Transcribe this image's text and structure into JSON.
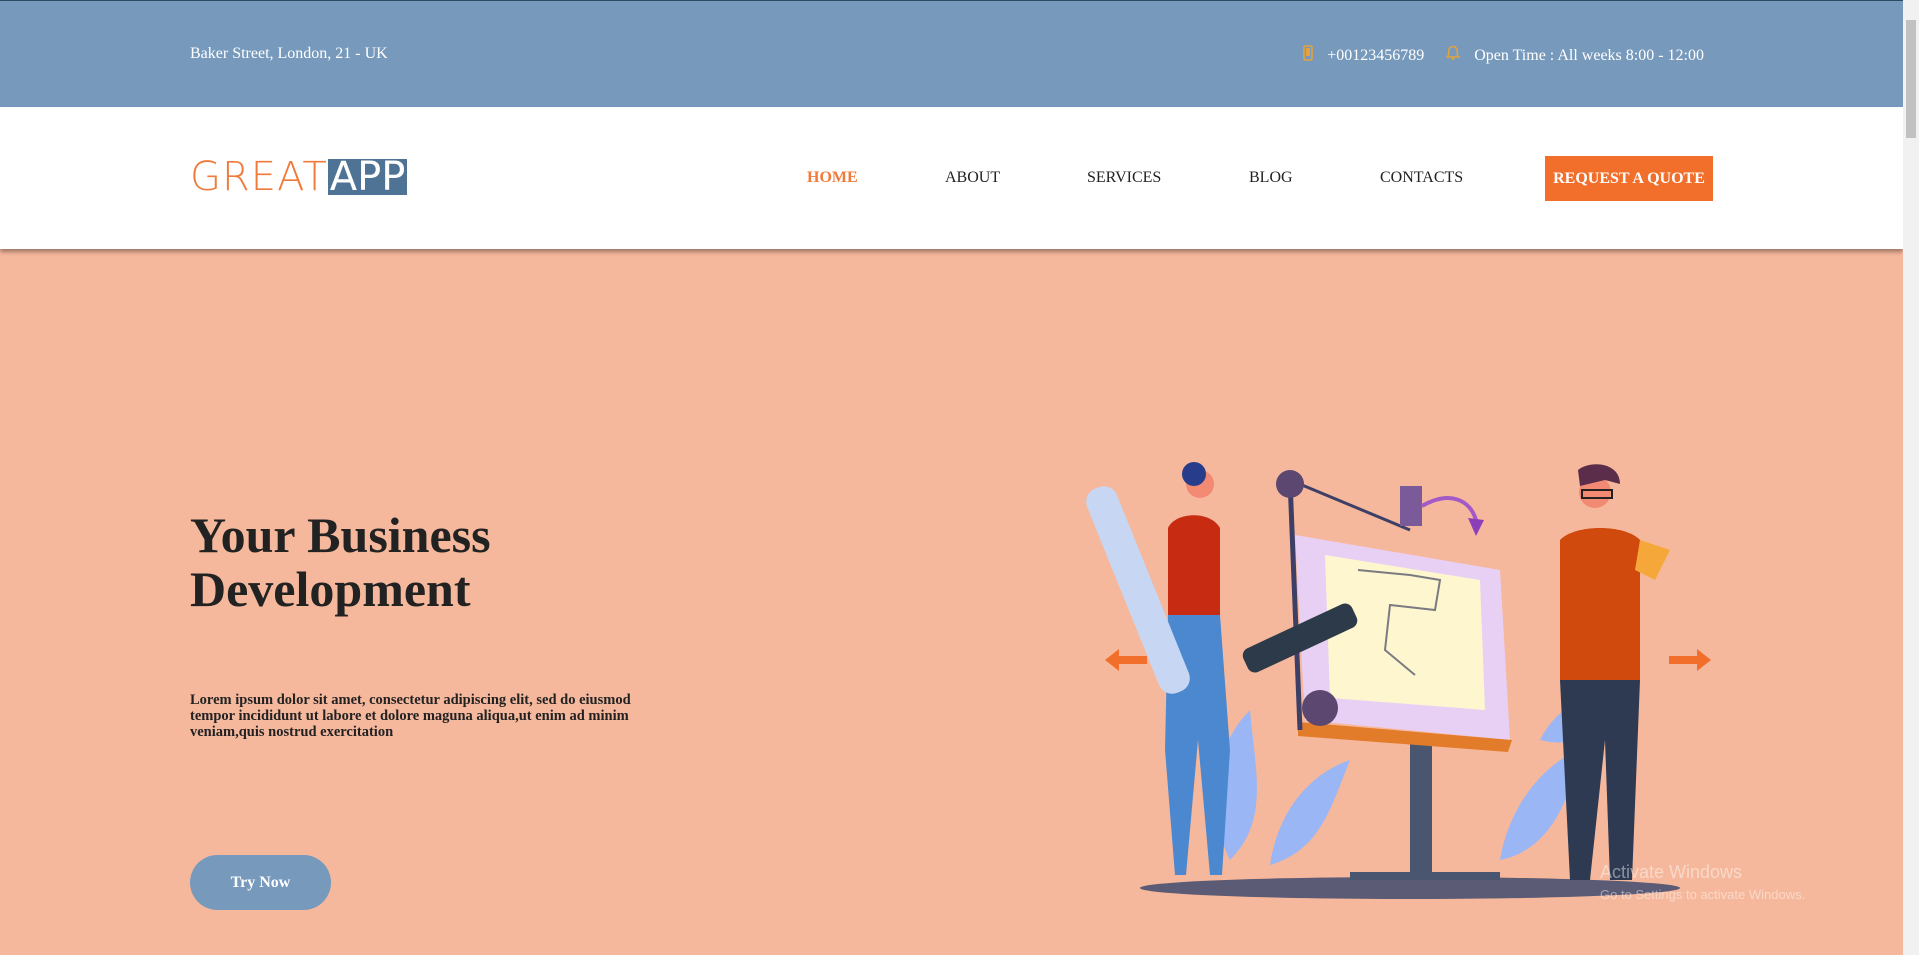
{
  "topbar": {
    "address": "Baker Street, London, 21 - UK",
    "phone": "+00123456789",
    "hours": "Open Time : All weeks 8:00 - 12:00",
    "phone_icon": "mobile-phone-icon",
    "hours_icon": "bell-icon"
  },
  "logo": {
    "part1": "GREAT",
    "part2": "APP"
  },
  "nav": {
    "items": [
      "HOME",
      "ABOUT",
      "SERVICES",
      "BLOG",
      "CONTACTS"
    ],
    "active": "HOME",
    "cta": "REQUEST A QUOTE"
  },
  "hero": {
    "title_line1": "Your Business",
    "title_line2": "Development",
    "text": "Lorem ipsum dolor sit amet, consectetur adipiscing elit, sed do eiusmod tempor incididunt ut labore et dolore maguna aliqua,ut enim ad minim veniam,quis nostrud exercitation",
    "button": "Try Now"
  },
  "watermark": {
    "line1": "Activate Windows",
    "line2": "Go to Settings to activate Windows."
  },
  "colors": {
    "topbar_bg": "#7699bc",
    "hero_bg": "#f6b89c",
    "accent": "#f26f2b",
    "logo_box": "#4f7395"
  }
}
